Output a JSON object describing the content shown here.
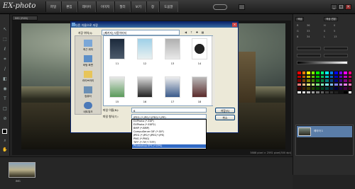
{
  "app": {
    "logo": "EX-photo"
  },
  "menubar": {
    "items": [
      "파일",
      "편집",
      "레이어",
      "이미지",
      "필터",
      "보기",
      "창",
      "도움말"
    ]
  },
  "window": {
    "minimize": "_",
    "maximize": "□",
    "close": "×"
  },
  "document": {
    "tab": "IMG (RGB)",
    "status": "3888 pixel × 2592 pixel(300 dpi)"
  },
  "filmstrip": {
    "thumb_label": "IMG"
  },
  "right_panel": {
    "tab1": "색상",
    "tab2": "색상 견본",
    "rows": [
      "R",
      "G",
      "B",
      "H",
      "S",
      "L"
    ],
    "values": [
      "36",
      "33",
      "34",
      "0",
      "5",
      "13"
    ],
    "layer_name": "레이어 1"
  },
  "swatch_colors": [
    "#ff0000",
    "#ff8000",
    "#ffff00",
    "#80ff00",
    "#00ff00",
    "#00ff80",
    "#00ffff",
    "#0080ff",
    "#0000ff",
    "#8000ff",
    "#ff00ff",
    "#ff0080",
    "#c00000",
    "#c06000",
    "#c0c000",
    "#60c000",
    "#00c000",
    "#00c060",
    "#00c0c0",
    "#0060c0",
    "#0000c0",
    "#6000c0",
    "#c000c0",
    "#c00060",
    "#800000",
    "#804000",
    "#808000",
    "#408000",
    "#008000",
    "#008040",
    "#008080",
    "#004080",
    "#000080",
    "#400080",
    "#800080",
    "#800040",
    "#ff8080",
    "#ffc080",
    "#ffff80",
    "#c0ff80",
    "#80ff80",
    "#80ffc0",
    "#80ffff",
    "#80c0ff",
    "#8080ff",
    "#c080ff",
    "#ff80ff",
    "#ff80c0",
    "#400000",
    "#402000",
    "#404000",
    "#204000",
    "#004000",
    "#004020",
    "#004040",
    "#002040",
    "#000040",
    "#200040",
    "#400040",
    "#400020",
    "#ffffff",
    "#e0e0e0",
    "#c0c0c0",
    "#a0a0a0",
    "#808080",
    "#606060",
    "#404040",
    "#303030",
    "#202020",
    "#101010",
    "#000000",
    "#ffffff"
  ],
  "dialog": {
    "title": "다른 이름으로 저장",
    "close": "×",
    "look_in_label": "저장 위치(I):",
    "look_in_value": "[패키지] 사용이미지",
    "places": [
      "최근 위치",
      "바탕 화면",
      "라이브러리",
      "컴퓨터",
      "네트워크"
    ],
    "files": [
      "11",
      "12",
      "13",
      "14",
      "15",
      "16",
      "17",
      "18"
    ],
    "filename_label": "파일 이름(N):",
    "filename_value": "6",
    "filetype_label": "파일 형식(T):",
    "filetype_value": "JPEG (*.JPG;*.JPEG;*.JPE)",
    "save_button": "저장(S)",
    "cancel_button": "취소",
    "filetype_options": [
      "EXPhoto (*.EXP)",
      "EXPhoto (*.EXP2)",
      "BMP (*.BMP)",
      "CompuServe GIF (*.GIF)",
      "JPEG (*.JPG;*.JPEG;*.JPE)",
      "PNG (*.PNG)",
      "TIFF (*.TIF;*.TIFF)",
      "Photoshop EPS (*.EPS)"
    ],
    "selected_option_index": 7
  }
}
